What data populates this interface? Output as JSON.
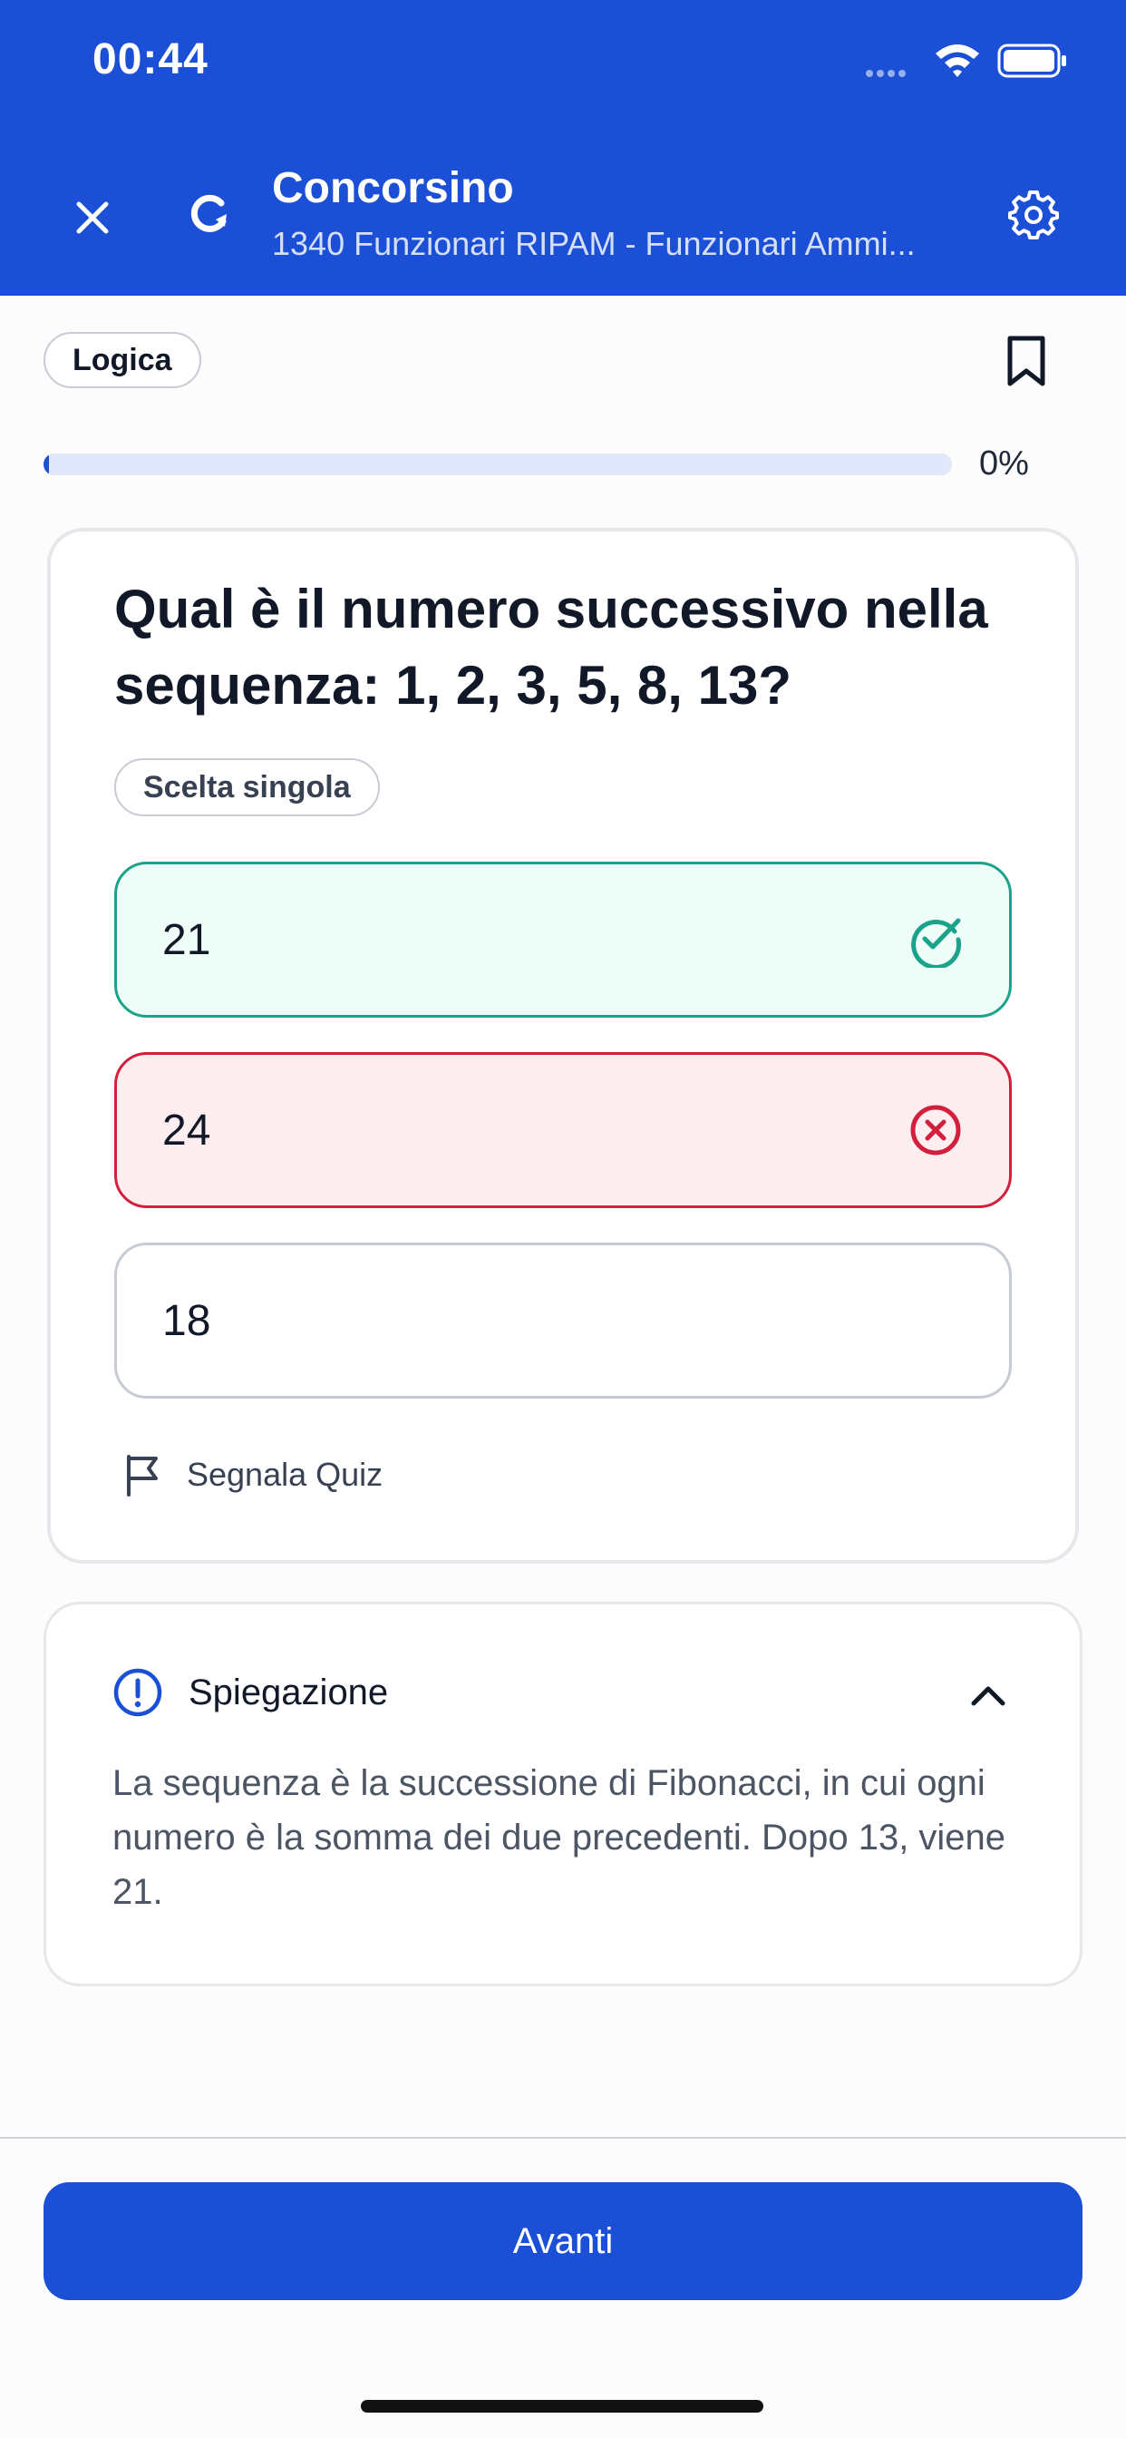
{
  "status_bar": {
    "time": "00:44",
    "signal_icon": "signal-dots-icon",
    "wifi_icon": "wifi-icon",
    "battery_icon": "battery-icon"
  },
  "header": {
    "title": "Concorsino",
    "subtitle": "1340 Funzionari RIPAM - Funzionari Ammi...",
    "close_icon": "close-icon",
    "refresh_icon": "refresh-icon",
    "settings_icon": "gear-icon",
    "background_color": "#1a4fd6"
  },
  "category": {
    "label": "Logica",
    "bookmark_icon": "bookmark-icon"
  },
  "progress": {
    "percent_label": "0%",
    "value": 0
  },
  "question": {
    "text": "Qual è il numero successivo nella sequenza: 1, 2, 3, 5, 8, 13?",
    "type_label": "Scelta singola",
    "options": [
      {
        "label": "21",
        "state": "correct",
        "icon": "check-circle-icon",
        "color": "#1aa38a"
      },
      {
        "label": "24",
        "state": "wrong",
        "icon": "x-circle-icon",
        "color": "#d21f3c"
      },
      {
        "label": "18",
        "state": "neutral"
      }
    ],
    "report_label": "Segnala Quiz",
    "report_icon": "flag-icon"
  },
  "explanation": {
    "title": "Spiegazione",
    "icon": "alert-circle-icon",
    "chevron_icon": "chevron-up-icon",
    "text": "La sequenza è la successione di Fibonacci, in cui ogni numero è la somma dei due precedenti. Dopo 13, viene 21."
  },
  "footer": {
    "next_label": "Avanti"
  }
}
